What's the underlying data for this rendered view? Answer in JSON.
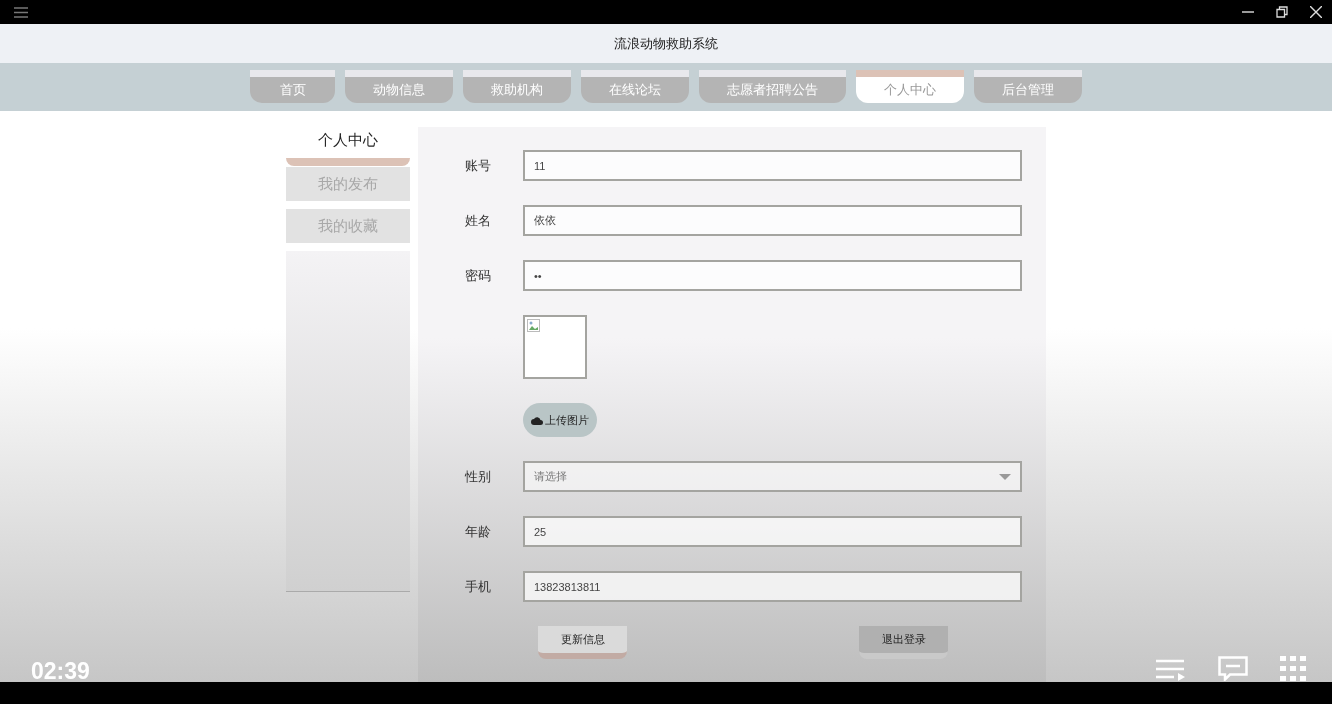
{
  "header": {
    "title": "流浪动物救助系统"
  },
  "nav_tabs": [
    {
      "label": "首页",
      "selected": false
    },
    {
      "label": "动物信息",
      "selected": false
    },
    {
      "label": "救助机构",
      "selected": false
    },
    {
      "label": "在线论坛",
      "selected": false
    },
    {
      "label": "志愿者招聘公告",
      "selected": false
    },
    {
      "label": "个人中心",
      "selected": true
    },
    {
      "label": "后台管理",
      "selected": false
    }
  ],
  "sidebar": {
    "title": "个人中心",
    "items": [
      "我的发布",
      "我的收藏"
    ]
  },
  "form": {
    "fields": [
      {
        "kind": "text",
        "label": "账号",
        "value": "11"
      },
      {
        "kind": "text",
        "label": "姓名",
        "value": "依依"
      },
      {
        "kind": "text",
        "label": "密码",
        "value": "••"
      },
      {
        "kind": "image"
      },
      {
        "kind": "upload",
        "label": "上传图片"
      },
      {
        "kind": "select",
        "label": "性别",
        "placeholder": "请选择"
      },
      {
        "kind": "text",
        "label": "年龄",
        "value": "25"
      },
      {
        "kind": "text",
        "label": "手机",
        "value": "13823813811"
      }
    ],
    "buttons": [
      {
        "kind": "accent",
        "label": "更新信息"
      },
      {
        "kind": "plain",
        "label": "退出登录"
      }
    ]
  },
  "video_overlay": {
    "time": "02:39"
  }
}
